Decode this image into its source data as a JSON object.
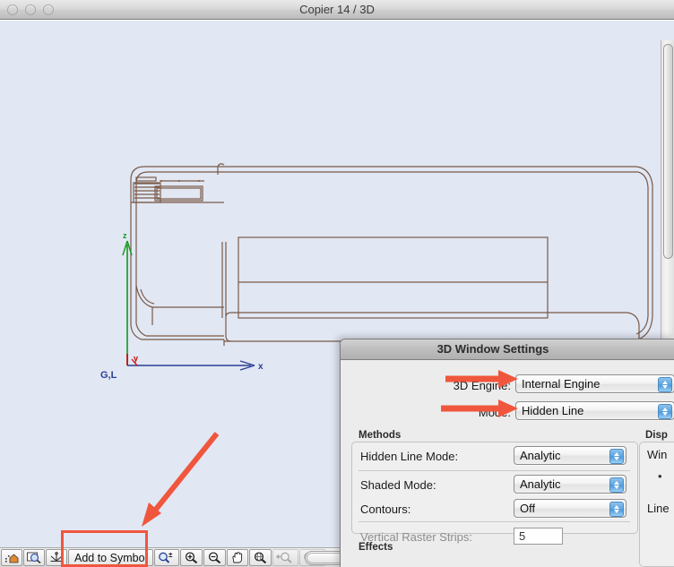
{
  "window": {
    "title": "Copier 14 / 3D",
    "traffic_lights": [
      "close",
      "minimize",
      "zoom"
    ]
  },
  "drawing": {
    "axis_labels": {
      "x": "x",
      "y": "y",
      "z": "z",
      "origin": "G,L"
    },
    "colors": {
      "background": "#e1e7f3",
      "geometry": "#7a5a48",
      "x_axis": "#2b3f93",
      "y_axis": "#cc0000",
      "z_axis": "#11991b"
    }
  },
  "bottom_toolbar": {
    "icons": [
      {
        "name": "home-zoom-icon",
        "glyph": "⌂"
      },
      {
        "name": "zoom-selection-icon",
        "glyph": "⌕"
      },
      {
        "name": "anchor-axis-icon",
        "glyph": "⚓"
      }
    ],
    "add_to_symbol_label": "Add to Symbol",
    "zoom_tools": [
      {
        "name": "marquee-zoom-icon",
        "glyph": "⌕",
        "sup": "±",
        "disabled": false
      },
      {
        "name": "zoom-in-icon",
        "glyph": "⌕",
        "sup": "+",
        "disabled": false
      },
      {
        "name": "zoom-out-icon",
        "glyph": "⌕",
        "sup": "−",
        "disabled": false
      },
      {
        "name": "pan-hand-icon",
        "glyph": "✋",
        "sup": "",
        "disabled": false
      },
      {
        "name": "orbit-globe-icon",
        "glyph": "⌕",
        "sup": "◌",
        "disabled": false
      },
      {
        "name": "zoom-previous-icon",
        "glyph": "⌕",
        "sup": "←",
        "disabled": true
      },
      {
        "name": "zoom-next-icon",
        "glyph": "⌕",
        "sup": "→",
        "disabled": true
      }
    ]
  },
  "dialog": {
    "title": "3D Window Settings",
    "engine": {
      "label": "3D Engine:",
      "value": "Internal Engine"
    },
    "mode": {
      "label": "Mode:",
      "value": "Hidden Line"
    },
    "methods": {
      "group_label": "Methods",
      "hidden_line_mode": {
        "label": "Hidden Line Mode:",
        "value": "Analytic"
      },
      "shaded_mode": {
        "label": "Shaded Mode:",
        "value": "Analytic"
      },
      "contours": {
        "label": "Contours:",
        "value": "Off"
      },
      "vertical_raster_strips": {
        "label": "Vertical Raster Strips:",
        "value": "5",
        "enabled": false
      }
    },
    "effects": {
      "group_label": "Effects"
    },
    "display_panel": {
      "group_label": "Disp",
      "window_label": "Win",
      "line_label": "Line"
    }
  },
  "annotations": {
    "color": "#f0563d",
    "arrows": [
      {
        "name": "arrow-to-engine-dropdown",
        "target": "3D Engine dropdown"
      },
      {
        "name": "arrow-to-mode-dropdown",
        "target": "Mode dropdown"
      },
      {
        "name": "arrow-to-add-to-symbol",
        "target": "Add to Symbol button"
      }
    ],
    "highlight_box": {
      "name": "add-to-symbol-highlight",
      "target": "Add to Symbol button"
    }
  }
}
